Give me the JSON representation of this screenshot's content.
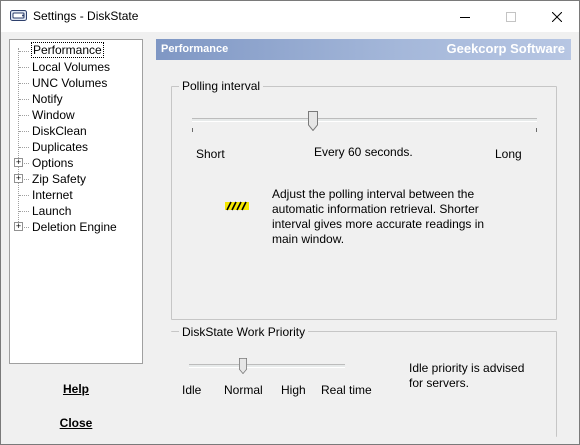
{
  "window": {
    "title": "Settings - DiskState"
  },
  "titlebar_buttons": {
    "minimize": "—",
    "maximize": "☐",
    "close": "✕"
  },
  "tree": {
    "items": [
      {
        "label": "Performance",
        "expandable": false,
        "selected": true
      },
      {
        "label": "Local Volumes",
        "expandable": false,
        "selected": false
      },
      {
        "label": "UNC Volumes",
        "expandable": false,
        "selected": false
      },
      {
        "label": "Notify",
        "expandable": false,
        "selected": false
      },
      {
        "label": "Window",
        "expandable": false,
        "selected": false
      },
      {
        "label": "DiskClean",
        "expandable": false,
        "selected": false
      },
      {
        "label": "Duplicates",
        "expandable": false,
        "selected": false
      },
      {
        "label": "Options",
        "expandable": true,
        "selected": false
      },
      {
        "label": "Zip Safety",
        "expandable": true,
        "selected": false
      },
      {
        "label": "Internet",
        "expandable": false,
        "selected": false
      },
      {
        "label": "Launch",
        "expandable": false,
        "selected": false
      },
      {
        "label": "Deletion Engine",
        "expandable": true,
        "selected": false
      }
    ]
  },
  "buttons": {
    "help": "Help",
    "close": "Close"
  },
  "banner": {
    "section": "Performance",
    "vendor": "Geekcorp Software",
    "accent": "#7f97c4"
  },
  "polling": {
    "group_title": "Polling interval",
    "min_label": "Short",
    "max_label": "Long",
    "value_text": "Every 60 seconds.",
    "value_fraction": 0.35,
    "icon": "lightning-icon",
    "description": "Adjust the polling interval between the automatic information retrieval. Shorter interval gives more accurate readings in main window."
  },
  "priority": {
    "group_title": "DiskState Work Priority",
    "levels": [
      "Idle",
      "Normal",
      "High",
      "Real time"
    ],
    "selected": "Normal",
    "note": "Idle priority is advised for servers."
  }
}
